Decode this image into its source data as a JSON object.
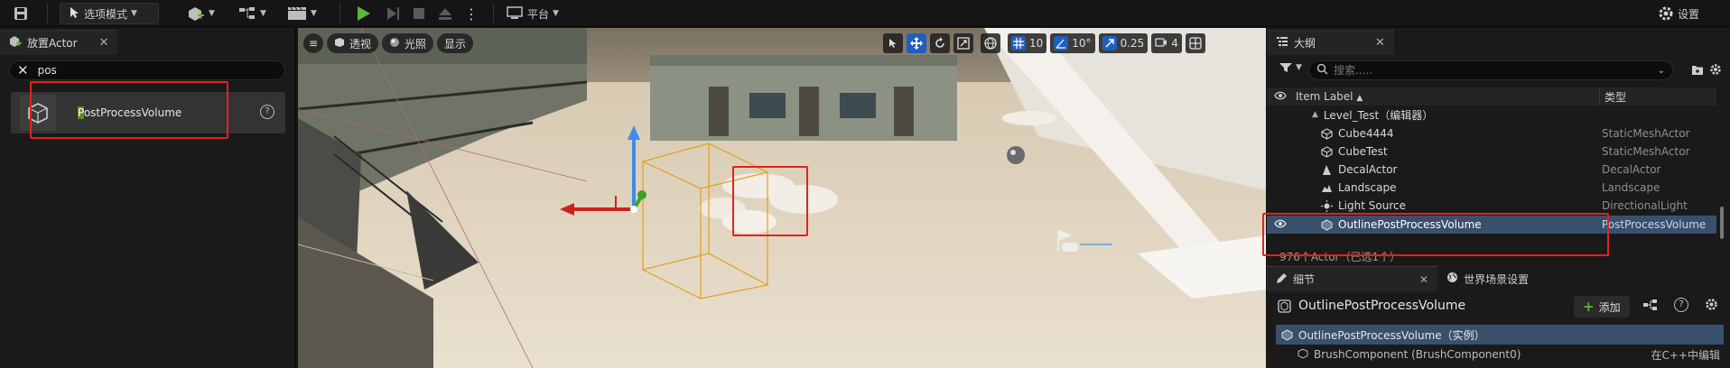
{
  "toolbar": {
    "mode_label": "选项模式",
    "platform_label": "平台",
    "settings_label": "设置"
  },
  "place_actor": {
    "tab_title": "放置Actor",
    "search_value": "pos",
    "result": {
      "highlight": "P",
      "rest": "ostProcessVolume"
    }
  },
  "viewport": {
    "perspective_label": "透视",
    "lighting_label": "光照",
    "show_label": "显示",
    "grid_snap": "10",
    "rotation_snap": "10°",
    "scale_snap": "0.25",
    "camera_speed": "4"
  },
  "outliner": {
    "tab_title": "大纲",
    "search_placeholder": "搜索.....",
    "col_label": "Item Label",
    "col_type": "类型",
    "level": "Level_Test（编辑器）",
    "items": [
      {
        "label": "Cube4444",
        "type": "StaticMeshActor"
      },
      {
        "label": "CubeTest",
        "type": "StaticMeshActor"
      },
      {
        "label": "DecalActor",
        "type": "DecalActor"
      },
      {
        "label": "Landscape",
        "type": "Landscape"
      },
      {
        "label": "Light Source",
        "type": "DirectionalLight"
      },
      {
        "label": "OutlinePostProcessVolume",
        "type": "PostProcessVolume"
      }
    ],
    "status": "976个Actor（已选1个）"
  },
  "details": {
    "tab_details": "细节",
    "tab_world": "世界场景设置",
    "actor_name": "OutlinePostProcessVolume",
    "add_label": "添加",
    "instance_label": "OutlinePostProcessVolume（实例）",
    "component_label": "BrushComponent (BrushComponent0)",
    "component_note": "在C++中编辑"
  },
  "colors": {
    "accent_blue": "#1f5fbf",
    "selection": "#39506d",
    "highlight_red": "#e0231e",
    "play_green": "#5fb336"
  }
}
